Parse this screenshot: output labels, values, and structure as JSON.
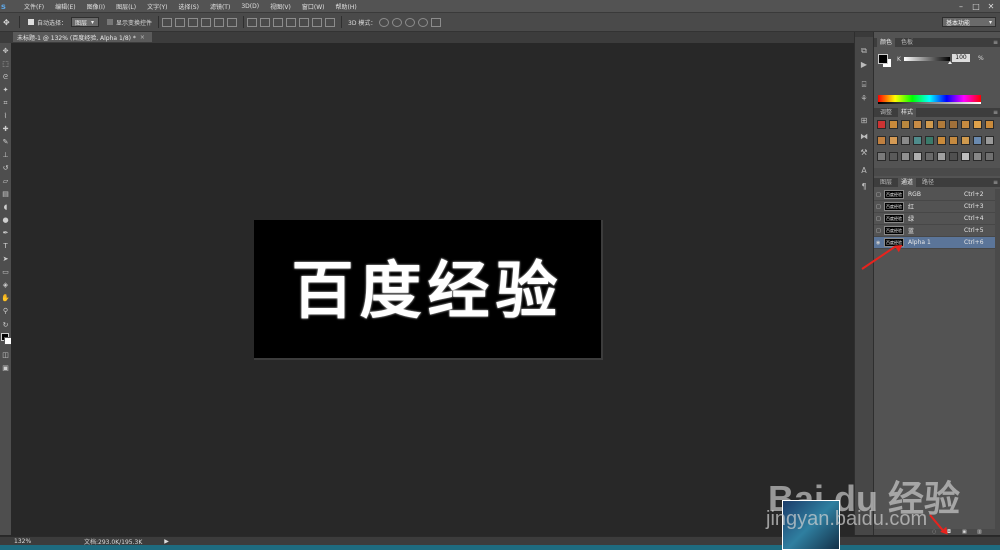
{
  "app": {
    "logo": "s"
  },
  "menu": [
    "文件(F)",
    "编辑(E)",
    "图像(I)",
    "图层(L)",
    "文字(Y)",
    "选择(S)",
    "滤镜(T)",
    "3D(D)",
    "视图(V)",
    "窗口(W)",
    "帮助(H)"
  ],
  "window_controls": {
    "minimize": "–",
    "maximize": "□",
    "close": "✕"
  },
  "options_bar": {
    "auto_select_label": "自动选择：",
    "auto_select_value": "图层",
    "show_transform_label": "显示变换控件",
    "mode_3d_label": "3D 模式：",
    "workspace": "基本功能"
  },
  "document_tab": {
    "title": "未标题-1 @ 132% (百度经验, Alpha 1/8) *",
    "close": "×"
  },
  "canvas": {
    "text": "百度经验"
  },
  "status": {
    "zoom": "132%",
    "doc_size": "文档:293.0K/195.3K",
    "arrow": "▶"
  },
  "color_panel": {
    "tabs": [
      "颜色",
      "色板"
    ],
    "channel_label": "K",
    "channel_value": "100",
    "unit": "%",
    "fg_color": "#000000",
    "bg_color": "#ffffff"
  },
  "styles_panel": {
    "tabs": [
      "调整",
      "样式"
    ]
  },
  "channels_panel": {
    "tabs": [
      "图层",
      "通道",
      "路径"
    ],
    "rows": [
      {
        "name": "RGB",
        "shortcut": "Ctrl+2",
        "thumb": "百度经验"
      },
      {
        "name": "红",
        "shortcut": "Ctrl+3",
        "thumb": "百度经验"
      },
      {
        "name": "绿",
        "shortcut": "Ctrl+4",
        "thumb": "百度经验"
      },
      {
        "name": "蓝",
        "shortcut": "Ctrl+5",
        "thumb": "百度经验"
      },
      {
        "name": "Alpha 1",
        "shortcut": "Ctrl+6",
        "thumb": "百度经验",
        "selected": true
      }
    ]
  },
  "watermark": {
    "brand": "Bai du 经验",
    "url": "jingyan.baidu.com"
  },
  "colors": {
    "accent_arrow": "#e8231d",
    "selection": "#5b7599",
    "taskbar": "#1e6b7f"
  }
}
